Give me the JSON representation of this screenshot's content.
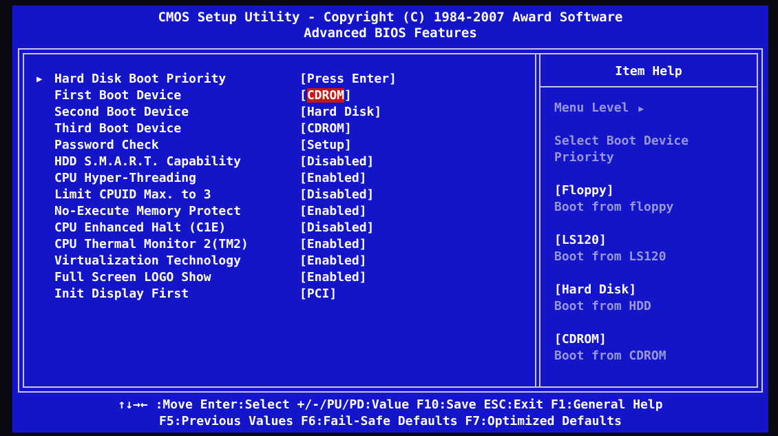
{
  "header": {
    "title": "CMOS Setup Utility - Copyright (C) 1984-2007 Award Software",
    "subtitle": "Advanced BIOS Features"
  },
  "settings": [
    {
      "label": "Hard Disk Boot Priority",
      "value": "[Press Enter]",
      "submenu": true
    },
    {
      "label": "First Boot Device",
      "value_prefix": "[",
      "value_highlight": "CDROM",
      "value_suffix": "]"
    },
    {
      "label": "Second Boot Device",
      "value": "[Hard Disk]"
    },
    {
      "label": "Third Boot Device",
      "value": "[CDROM]"
    },
    {
      "label": "Password Check",
      "value": "[Setup]"
    },
    {
      "label": "HDD S.M.A.R.T. Capability",
      "value": "[Disabled]"
    },
    {
      "label": "CPU Hyper-Threading",
      "value": "[Enabled]"
    },
    {
      "label": "Limit CPUID Max. to 3",
      "value": "[Disabled]"
    },
    {
      "label": "No-Execute Memory Protect",
      "value": "[Enabled]"
    },
    {
      "label": "CPU Enhanced Halt (C1E)",
      "value": "[Disabled]"
    },
    {
      "label": "CPU Thermal Monitor 2(TM2)",
      "value": "[Enabled]"
    },
    {
      "label": "Virtualization Technology",
      "value": "[Enabled]"
    },
    {
      "label": "Full Screen LOGO Show",
      "value": "[Enabled]"
    },
    {
      "label": "Init Display First",
      "value": "[PCI]"
    }
  ],
  "help": {
    "title": "Item Help",
    "menu_level": "Menu Level",
    "desc1": "Select Boot Device",
    "desc2": "Priority",
    "opt1_name": "[Floppy]",
    "opt1_desc": "Boot from floppy",
    "opt2_name": "[LS120]",
    "opt2_desc": "Boot from LS120",
    "opt3_name": "[Hard Disk]",
    "opt3_desc": "Boot from HDD",
    "opt4_name": "[CDROM]",
    "opt4_desc": "Boot from CDROM"
  },
  "footer": {
    "line1": [
      "↑↓→← :Move",
      "Enter:Select",
      "+/-/PU/PD:Value",
      "F10:Save",
      "ESC:Exit",
      "F1:General Help"
    ],
    "line2": [
      "F5:Previous Values",
      "F6:Fail-Safe Defaults",
      "F7:Optimized Defaults"
    ]
  },
  "colors": {
    "background": "#1414c8",
    "text": "#ffffff",
    "help_text": "#9898d8",
    "highlight": "#cc1414",
    "border": "#c8c8d8"
  },
  "icons": {
    "submenu": "triangle-right-icon",
    "menu_level": "triangle-right-icon"
  }
}
